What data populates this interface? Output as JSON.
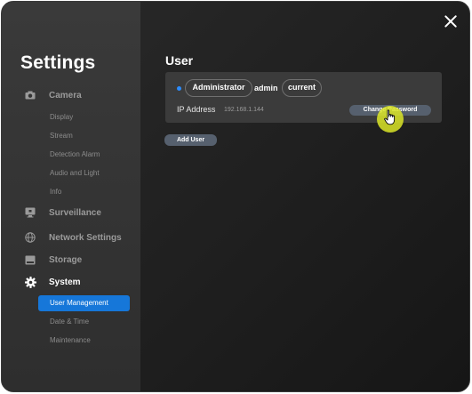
{
  "sidebar": {
    "title": "Settings",
    "categories": [
      {
        "label": "Camera",
        "icon": "camera-icon"
      },
      {
        "label": "Surveillance",
        "icon": "monitor-icon"
      },
      {
        "label": "Network Settings",
        "icon": "globe-icon"
      },
      {
        "label": "Storage",
        "icon": "storage-icon"
      },
      {
        "label": "System",
        "icon": "gear-icon"
      }
    ],
    "camera_items": [
      "Display",
      "Stream",
      "Detection Alarm",
      "Audio and Light",
      "Info"
    ],
    "system_items": [
      "User Management",
      "Date & Time",
      "Maintenance"
    ],
    "active_item": "User Management"
  },
  "main": {
    "section_title": "User",
    "user": {
      "role": "Administrator",
      "username": "admin",
      "status": "current",
      "ip_label": "IP Address",
      "ip_value": "192.168.1.144",
      "change_password_label": "Change Password"
    },
    "add_user_label": "Add User"
  },
  "colors": {
    "accent": "#1677d9",
    "status_dot": "#2b8cff",
    "button": "#56606e",
    "cursor_highlight": "#dce628"
  }
}
